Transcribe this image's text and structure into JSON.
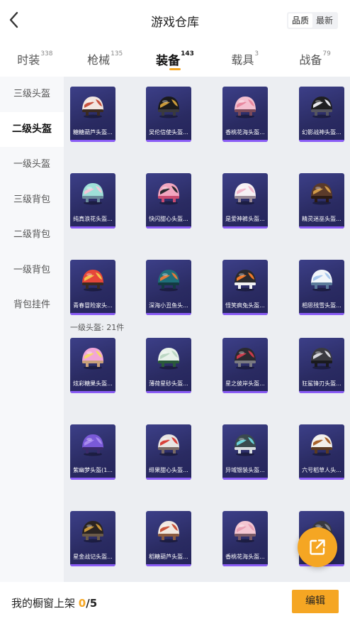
{
  "header": {
    "title": "游戏仓库",
    "sort_options": [
      "品质",
      "最新"
    ],
    "active_sort": 0
  },
  "tabs": [
    {
      "label": "时装",
      "count": "338"
    },
    {
      "label": "枪械",
      "count": "135"
    },
    {
      "label": "装备",
      "count": "143",
      "active": true
    },
    {
      "label": "载具",
      "count": "3"
    },
    {
      "label": "战备",
      "count": "79"
    }
  ],
  "sidebar": {
    "items": [
      "三级头盔",
      "二级头盔",
      "一级头盔",
      "三级背包",
      "二级背包",
      "一级背包",
      "背包挂件"
    ],
    "active_index": 1
  },
  "grid": {
    "rows": [
      [
        {
          "name": "糖糖葫芦头盔...",
          "colors": [
            "#f2e6e0",
            "#c8523e",
            "#3a2a22"
          ]
        },
        {
          "name": "吴伦信使头盔...",
          "colors": [
            "#1a1a1c",
            "#c99a3a",
            "#3a3a3e"
          ]
        },
        {
          "name": "香桃花海头盔...",
          "colors": [
            "#f4bfcf",
            "#e8889f",
            "#7b4a5a"
          ]
        },
        {
          "name": "幻影战神头盔...",
          "colors": [
            "#1f1f22",
            "#e8e8ee",
            "#555560"
          ]
        }
      ],
      [
        {
          "name": "纯真浪花头盔...",
          "colors": [
            "#9fe0d8",
            "#f4c6d8",
            "#6a8a9a"
          ]
        },
        {
          "name": "快闪甜心头盔...",
          "colors": [
            "#f2a6bf",
            "#2a2a30",
            "#c84a70"
          ]
        },
        {
          "name": "是爱神裤头盔...",
          "colors": [
            "#f6f0f4",
            "#f1b6cb",
            "#9a8a96"
          ]
        },
        {
          "name": "精灵迷巫头盔...",
          "colors": [
            "#5a3a2a",
            "#d09a48",
            "#2a1a14"
          ]
        }
      ],
      [
        {
          "name": "青春冒险家头...",
          "colors": [
            "#e6463a",
            "#f2c24a",
            "#3a2a22"
          ]
        },
        {
          "name": "深海小丑鱼头...",
          "colors": [
            "#1f6f7a",
            "#e27a3a",
            "#143a42"
          ]
        },
        {
          "name": "怪笑疯兔头盔...",
          "colors": [
            "#2a2a2e",
            "#f07a2a",
            "#f0f0f2"
          ]
        },
        {
          "name": "相思残雪头盔...",
          "colors": [
            "#f2f6fa",
            "#a8c8ee",
            "#5a7a9a"
          ]
        }
      ]
    ],
    "section_label": "一级头盔: 21件",
    "section_rows": [
      [
        {
          "name": "炫彩糖果头盔...",
          "colors": [
            "#f2a6d8",
            "#f6d86a",
            "#c8a07a"
          ]
        },
        {
          "name": "薄荷星砂头盔...",
          "colors": [
            "#e8f2ea",
            "#bcd8c4",
            "#2a5a3a"
          ]
        },
        {
          "name": "星之彼岸头盔...",
          "colors": [
            "#2a2a30",
            "#c83a4a",
            "#7a7a82"
          ]
        },
        {
          "name": "狂鲨锋刃头盔...",
          "colors": [
            "#3a3a40",
            "#d8d8de",
            "#1a1a1e"
          ]
        }
      ],
      [
        {
          "name": "紫幽梦头盔(1...",
          "colors": [
            "#7a5ad8",
            "#a88aee",
            "#3a2a6a"
          ]
        },
        {
          "name": "绯果甜心头盔...",
          "colors": [
            "#e8e4e2",
            "#d8403a",
            "#7a6a66"
          ]
        },
        {
          "name": "异域银装头盔...",
          "colors": [
            "#3a4a4e",
            "#6ad0d8",
            "#d8dde0"
          ]
        },
        {
          "name": "六号稻草人头...",
          "colors": [
            "#f2f0ea",
            "#a8622a",
            "#5a3a22"
          ]
        }
      ],
      [
        {
          "name": "星金战记头盔...",
          "colors": [
            "#2a2422",
            "#c8963a",
            "#6a5a48"
          ]
        },
        {
          "name": "稻糖葫芦头盔...",
          "colors": [
            "#f2e8e0",
            "#c8523a",
            "#8a5a40"
          ]
        },
        {
          "name": "香桃花海头盔...",
          "colors": [
            "#f4c6d2",
            "#e8a0b4",
            "#7a5a66"
          ]
        },
        {
          "name": "…盔)",
          "colors": [
            "#3a3a40",
            "#8a8a92",
            "#1a1a1e"
          ]
        }
      ]
    ]
  },
  "footer": {
    "label": "我的橱窗上架",
    "current": "0",
    "separator": "/",
    "total": "5",
    "edit_label": "编辑"
  },
  "fab": {
    "icon": "share-external-icon"
  },
  "colors": {
    "accent": "#f5a623",
    "card_bg": "#2a2b62",
    "card_stripe": "#8a5cf5"
  }
}
